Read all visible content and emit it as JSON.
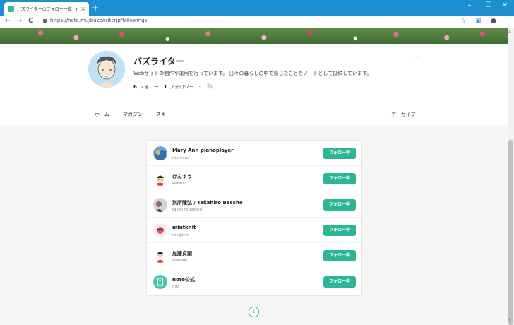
{
  "browser": {
    "tab_title": "バズライターのフォロー一覧：note",
    "tab_close": "×",
    "new_tab": "+",
    "url": "https://note.mu/buzzwriterjp/followings",
    "window_controls": [
      "–",
      "☐",
      "✕"
    ],
    "nav": {
      "back": "←",
      "forward": "→",
      "reload": "C"
    },
    "toolbar_icons": {
      "star": "☆",
      "menu": "⋮"
    }
  },
  "profile": {
    "name": "バズライター",
    "more": "···",
    "description": "Webサイトの制作や運用を行っています。 日々の暮らしの中で感じたことをノートとして投稿しています。",
    "following_count": "6",
    "following_label": "フォロー",
    "followers_count": "1",
    "followers_label": "フォロワー",
    "dot": "·"
  },
  "tabs": [
    "ホーム",
    "マガジン",
    "スキ",
    "アーカイブ"
  ],
  "users": [
    {
      "name": "Mary Ann pianoplayer",
      "id": "maryann",
      "button": "フォロー中"
    },
    {
      "name": "けんすう",
      "id": "kensuu",
      "button": "フォロー中"
    },
    {
      "name": "別所隆弘 / Takahiro Bessho",
      "id": "takahirobessho",
      "button": "フォロー中"
    },
    {
      "name": "mintknit",
      "id": "megknit",
      "button": "フォロー中"
    },
    {
      "name": "加藤貞顕",
      "id": "sadaaki",
      "button": "フォロー中"
    },
    {
      "name": "note公式",
      "id": "info",
      "button": "フォロー中"
    }
  ],
  "pagination": {
    "current": "1"
  },
  "colors": {
    "accent": "#2cb696",
    "titlebar": "#1d8fd0"
  }
}
